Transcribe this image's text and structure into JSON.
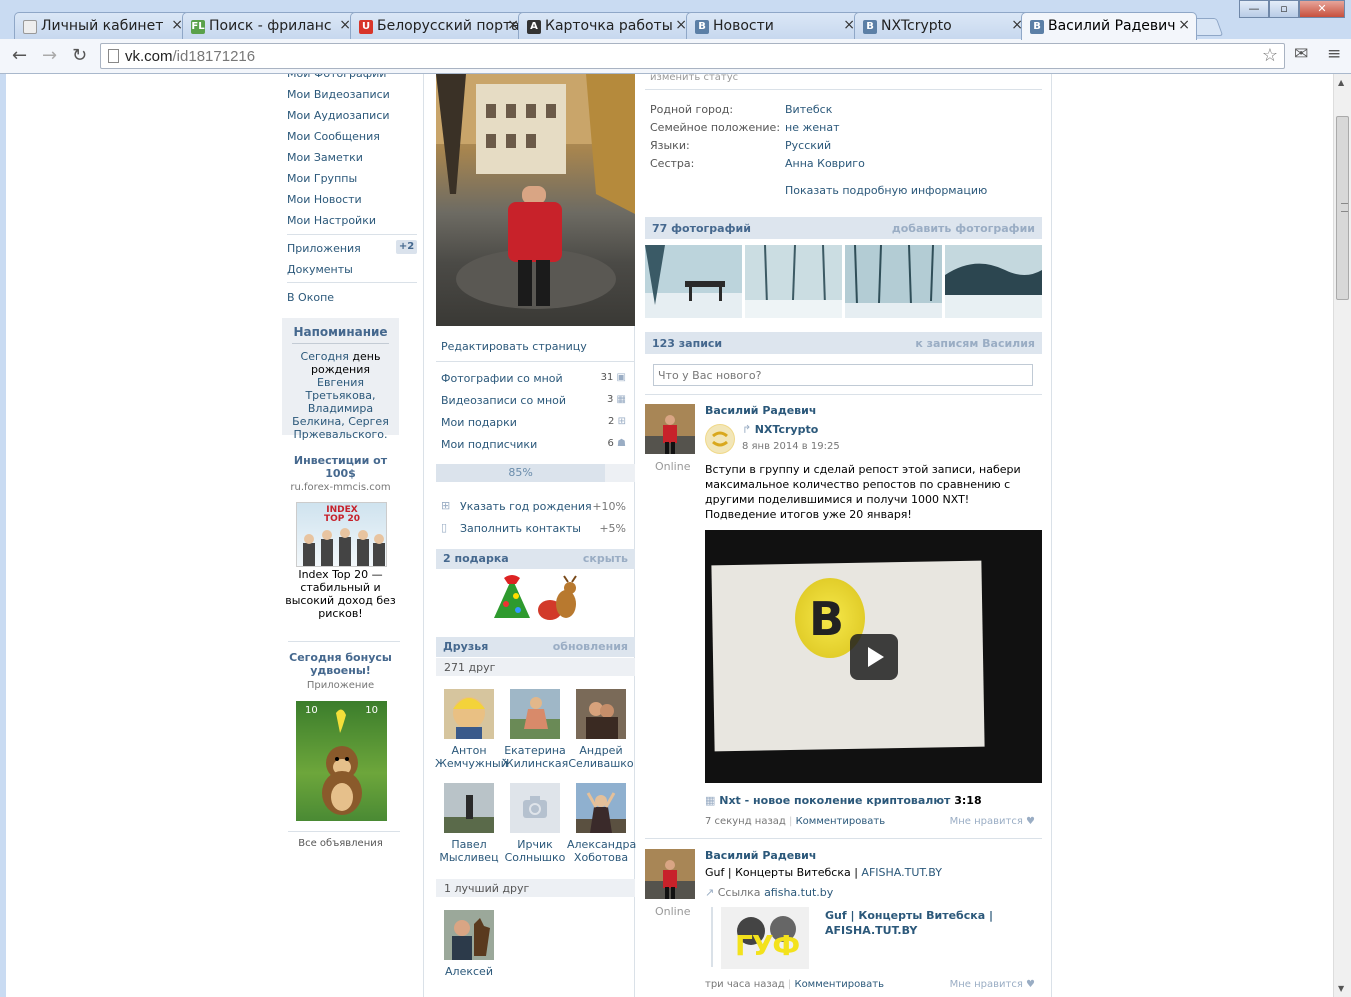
{
  "browser": {
    "tabs": [
      {
        "title": "Личный кабинет",
        "favicon": "page-icon",
        "color": "#dddddd"
      },
      {
        "title": "Поиск - фриланс",
        "favicon": "FL",
        "color": "#5aa14a"
      },
      {
        "title": "Белорусский портал",
        "favicon": "U",
        "color": "#d8352a"
      },
      {
        "title": "Карточка работы",
        "favicon": "A",
        "color": "#333333"
      },
      {
        "title": "Новости",
        "favicon": "B",
        "color": "#5b7fa6"
      },
      {
        "title": "NXTcrypto",
        "favicon": "B",
        "color": "#5b7fa6"
      },
      {
        "title": "Василий Радевич",
        "favicon": "B",
        "color": "#5b7fa6"
      }
    ],
    "url_domain": "vk.com",
    "url_path": "/id18171216"
  },
  "leftnav": {
    "items": [
      "Мои Фотографии",
      "Мои Видеозаписи",
      "Мои Аудиозаписи",
      "Мои Сообщения",
      "Мои Заметки",
      "Мои Группы",
      "Мои Новости",
      "Мои Настройки"
    ],
    "apps": "Приложения",
    "apps_badge": "+2",
    "docs": "Документы",
    "okope": "В Окопе"
  },
  "reminder": {
    "title": "Напоминание",
    "text_today": "Сегодня",
    "text_birthday": "день рождения",
    "names": "Евгения Третьякова, Владимира Белкина, Сергея Пржевальского."
  },
  "ads": {
    "ad1_title": "Инвестиции от 100$",
    "ad1_domain": "ru.forex-mmcis.com",
    "ad1_img_text": "INDEX TOP 20",
    "ad1_text": "Index Top 20 — стабильный и высокий доход без рисков!",
    "ad2_title": "Сегодня бонусы удвоены!",
    "ad2_sub": "Приложение",
    "ad2_score_left": "10",
    "ad2_score_right": "10",
    "all_ads": "Все объявления"
  },
  "middle": {
    "edit_page": "Редактировать страницу",
    "links": [
      {
        "label": "Фотографии со мной",
        "count": "31",
        "icon": "camera-icon"
      },
      {
        "label": "Видеозаписи со мной",
        "count": "3",
        "icon": "film-icon"
      },
      {
        "label": "Мои подарки",
        "count": "2",
        "icon": "gift-icon"
      },
      {
        "label": "Мои подписчики",
        "count": "6",
        "icon": "people-icon"
      }
    ],
    "progress_value": 0.85,
    "progress_text": "85%",
    "tasks": [
      {
        "label": "Указать год рождения",
        "bonus": "+10%",
        "icon": "gift-icon"
      },
      {
        "label": "Заполнить контакты",
        "bonus": "+5%",
        "icon": "phone-icon"
      }
    ],
    "gifts_title": "2 подарка",
    "gifts_hide": "скрыть",
    "friends_title": "Друзья",
    "friends_updates": "обновления",
    "friends_count": "271 друг",
    "friends": [
      {
        "first": "Антон",
        "last": "Жемчужный"
      },
      {
        "first": "Екатерина",
        "last": "Жилинская"
      },
      {
        "first": "Андрей",
        "last": "Селивашко"
      },
      {
        "first": "Павел",
        "last": "Мысливец"
      },
      {
        "first": "Ирчик",
        "last": "Солнышко"
      },
      {
        "first": "Александра",
        "last": "Хоботова"
      }
    ],
    "best_friend_title": "1 лучший друг",
    "best_friend": "Алексей"
  },
  "right": {
    "change_status": "изменить статус",
    "info": [
      {
        "label": "Родной город:",
        "value": "Витебск"
      },
      {
        "label": "Семейное положение:",
        "value": "не женат"
      },
      {
        "label": "Языки:",
        "value": "Русский"
      },
      {
        "label": "Сестра:",
        "value": "Анна Ковриго"
      }
    ],
    "show_more": "Показать подробную информацию",
    "photos_title": "77 фотографий",
    "photos_add": "добавить фотографии",
    "wall_title": "123 записи",
    "wall_link": "к записям Василия",
    "status_placeholder": "Что у Вас нового?",
    "post1": {
      "author": "Василий Радевич",
      "online": "Online",
      "repost_from": "NXTcrypto",
      "date": "8 янв 2014 в 19:25",
      "text1": "Вступи в группу и сделай репост этой записи, набери максимальное количество репостов по сравнению с другими поделившимися и получи 1000 NXT!",
      "text2": "Подведение итогов уже 20 января!",
      "video_title": "Nxt - новое поколение криптовалют",
      "video_duration": "3:18",
      "time": "7 секунд назад",
      "comment": "Комментировать",
      "like": "Мне нравится"
    },
    "post2": {
      "author": "Василий Радевич",
      "online": "Online",
      "text": "Guf | Концерты Витебска |",
      "text_link": "AFISHA.TUT.BY",
      "link_label": "Ссылка",
      "link_domain": "afisha.tut.by",
      "card_title": "Guf | Концерты Витебска | AFISHA.TUT.BY",
      "card_img_text": "ГУФ",
      "time": "три часа назад",
      "comment": "Комментировать",
      "like": "Мне нравится"
    }
  }
}
